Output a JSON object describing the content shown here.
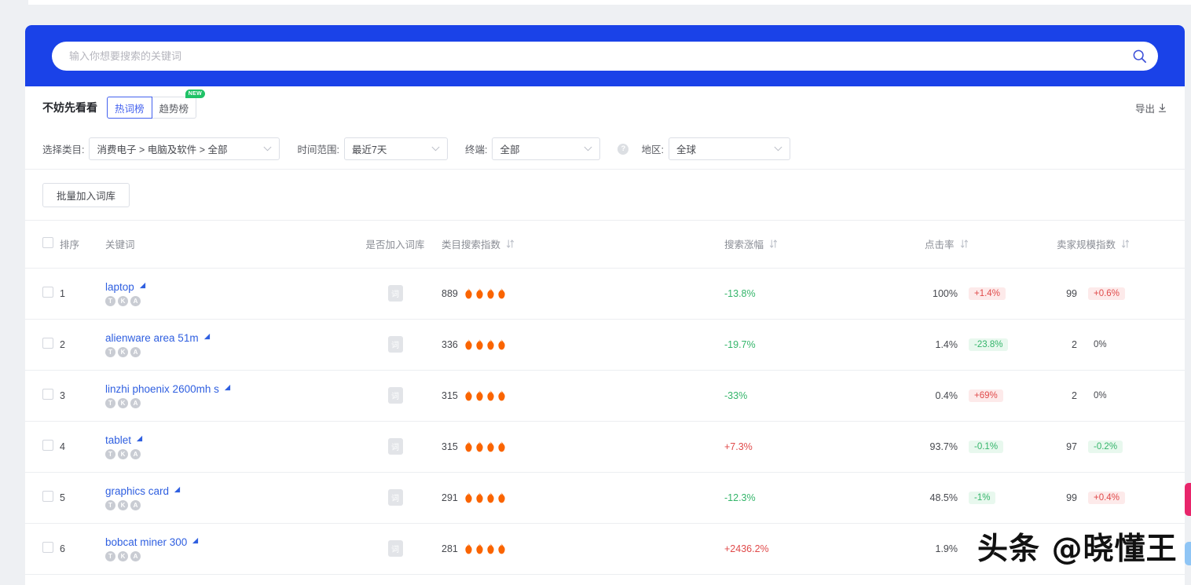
{
  "search": {
    "placeholder": "输入你想要搜索的关键词",
    "value": "",
    "icon": "search-icon"
  },
  "tabs_section": {
    "title": "不妨先看看",
    "tabs": [
      {
        "label": "热词榜",
        "active": true,
        "badge": ""
      },
      {
        "label": "趋势榜",
        "active": false,
        "badge": "NEW"
      }
    ],
    "export_label": "导出",
    "export_icon": "download-icon"
  },
  "filters": [
    {
      "label": "选择类目:",
      "value": "消费电子 > 电脑及软件 > 全部",
      "name": "category"
    },
    {
      "label": "时间范围:",
      "value": "最近7天",
      "name": "time-range"
    },
    {
      "label": "终端:",
      "value": "全部",
      "name": "terminal"
    },
    {
      "label": "地区:",
      "value": "全球",
      "name": "region"
    }
  ],
  "help_icon_label": "?",
  "bulk_button_label": "批量加入词库",
  "table": {
    "columns": [
      {
        "label": "排序",
        "sortable": false
      },
      {
        "label": "关键词",
        "sortable": false
      },
      {
        "label": "是否加入词库",
        "sortable": false
      },
      {
        "label": "类目搜索指数",
        "sortable": true
      },
      {
        "label": "搜索涨幅",
        "sortable": true
      },
      {
        "label": "点击率",
        "sortable": true
      },
      {
        "label": "卖家规模指数",
        "sortable": true
      }
    ],
    "badge_letters": [
      "T",
      "K",
      "A"
    ],
    "lib_chip_label": "词",
    "rows": [
      {
        "rank": "1",
        "keyword": "laptop",
        "index": "889",
        "flames": 4,
        "growth": "-13.8%",
        "growth_dir": "down",
        "ctr": "100%",
        "ctr_delta": "+1.4%",
        "ctr_delta_dir": "up",
        "seller": "99",
        "seller_delta": "+0.6%",
        "seller_delta_dir": "up"
      },
      {
        "rank": "2",
        "keyword": "alienware area 51m",
        "index": "336",
        "flames": 4,
        "growth": "-19.7%",
        "growth_dir": "down",
        "ctr": "1.4%",
        "ctr_delta": "-23.8%",
        "ctr_delta_dir": "down",
        "seller": "2",
        "seller_delta": "0%",
        "seller_delta_dir": "flat"
      },
      {
        "rank": "3",
        "keyword": "linzhi phoenix 2600mh s",
        "index": "315",
        "flames": 4,
        "growth": "-33%",
        "growth_dir": "down",
        "ctr": "0.4%",
        "ctr_delta": "+69%",
        "ctr_delta_dir": "up",
        "seller": "2",
        "seller_delta": "0%",
        "seller_delta_dir": "flat"
      },
      {
        "rank": "4",
        "keyword": "tablet",
        "index": "315",
        "flames": 4,
        "growth": "+7.3%",
        "growth_dir": "up",
        "ctr": "93.7%",
        "ctr_delta": "-0.1%",
        "ctr_delta_dir": "down",
        "seller": "97",
        "seller_delta": "-0.2%",
        "seller_delta_dir": "down"
      },
      {
        "rank": "5",
        "keyword": "graphics card",
        "index": "291",
        "flames": 4,
        "growth": "-12.3%",
        "growth_dir": "down",
        "ctr": "48.5%",
        "ctr_delta": "-1%",
        "ctr_delta_dir": "down",
        "seller": "99",
        "seller_delta": "+0.4%",
        "seller_delta_dir": "up"
      },
      {
        "rank": "6",
        "keyword": "bobcat miner 300",
        "index": "281",
        "flames": 4,
        "growth": "+2436.2%",
        "growth_dir": "up",
        "ctr": "1.9%",
        "ctr_delta": "",
        "ctr_delta_dir": "flat",
        "seller": "",
        "seller_delta": "",
        "seller_delta_dir": "flat"
      }
    ]
  },
  "watermark": "头条 @晓懂王",
  "colors": {
    "brand_blue": "#1a42e8",
    "tab_active": "#4361ee",
    "link_blue": "#2f5fe0",
    "flame_orange": "#fa6400",
    "up_red": "#e04a4a",
    "down_green": "#34b56a",
    "new_green": "#20c267"
  }
}
